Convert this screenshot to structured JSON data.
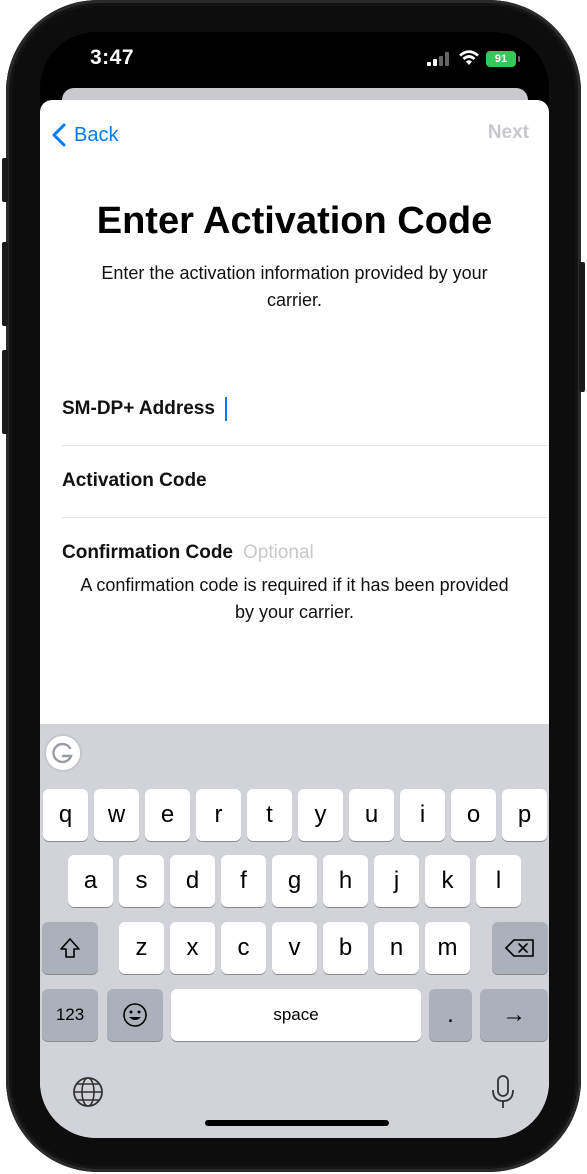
{
  "status_bar": {
    "time": "3:47",
    "battery": "91",
    "signal_icon": "cellular-signal-icon",
    "wifi_icon": "wifi-icon"
  },
  "nav": {
    "back_label": "Back",
    "next_label": "Next"
  },
  "header": {
    "title": "Enter Activation Code",
    "subtitle": "Enter the activation information provided by your carrier."
  },
  "fields": [
    {
      "label": "SM-DP+ Address",
      "value": "",
      "placeholder": ""
    },
    {
      "label": "Activation Code",
      "value": "",
      "placeholder": ""
    },
    {
      "label": "Confirmation Code",
      "value": "",
      "placeholder": "Optional"
    }
  ],
  "note": "A confirmation code is required if it has been provided by your carrier.",
  "keyboard": {
    "row1": [
      "q",
      "w",
      "e",
      "r",
      "t",
      "y",
      "u",
      "i",
      "o",
      "p"
    ],
    "row2": [
      "a",
      "s",
      "d",
      "f",
      "g",
      "h",
      "j",
      "k",
      "l"
    ],
    "row3": [
      "z",
      "x",
      "c",
      "v",
      "b",
      "n",
      "m"
    ],
    "numbers_label": "123",
    "space_label": "space",
    "period_label": ".",
    "return_glyph": "→"
  },
  "colors": {
    "accent": "#007aff",
    "disabled": "#c7c7cc",
    "battery": "#34c759",
    "keyboard_bg": "#d1d3d9"
  }
}
